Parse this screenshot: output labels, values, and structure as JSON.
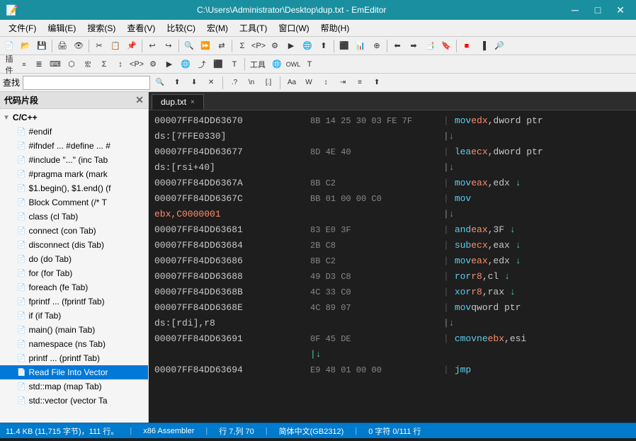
{
  "titlebar": {
    "title": "C:\\Users\\Administrator\\Desktop\\dup.txt - EmEditor",
    "minimize_label": "─",
    "maximize_label": "□",
    "close_label": "✕"
  },
  "menubar": {
    "items": [
      "文件(F)",
      "编辑(E)",
      "搜索(S)",
      "查看(V)",
      "比较(C)",
      "宏(M)",
      "工具(T)",
      "窗口(W)",
      "帮助(H)"
    ]
  },
  "searchbar": {
    "label": "查找",
    "placeholder": ""
  },
  "sidebar": {
    "title": "代码片段",
    "items": [
      {
        "id": "cpp-group",
        "label": "C/C++",
        "type": "folder",
        "expanded": true
      },
      {
        "id": "endif",
        "label": "#endif",
        "indent": 1
      },
      {
        "id": "ifndef",
        "label": "#ifndef ... #define ... #",
        "indent": 1
      },
      {
        "id": "include",
        "label": "#include \"...\" (inc Tab",
        "indent": 1
      },
      {
        "id": "pragma",
        "label": "#pragma mark (mark",
        "indent": 1
      },
      {
        "id": "begin",
        "label": "$1.begin(), $1.end() (f",
        "indent": 1
      },
      {
        "id": "block-comment",
        "label": "Block Comment (/* T",
        "indent": 1
      },
      {
        "id": "class",
        "label": "class (cl Tab)",
        "indent": 1
      },
      {
        "id": "connect",
        "label": "connect (con Tab)",
        "indent": 1
      },
      {
        "id": "disconnect",
        "label": "disconnect (dis Tab)",
        "indent": 1
      },
      {
        "id": "do",
        "label": "do (do Tab)",
        "indent": 1
      },
      {
        "id": "for",
        "label": "for (for Tab)",
        "indent": 1
      },
      {
        "id": "foreach",
        "label": "foreach (fe Tab)",
        "indent": 1
      },
      {
        "id": "fprintf",
        "label": "fprintf ... (fprintf Tab)",
        "indent": 1
      },
      {
        "id": "if",
        "label": "if (if Tab)",
        "indent": 1
      },
      {
        "id": "main",
        "label": "main() (main Tab)",
        "indent": 1
      },
      {
        "id": "namespace",
        "label": "namespace (ns Tab)",
        "indent": 1
      },
      {
        "id": "printf",
        "label": "printf ... (printf Tab)",
        "indent": 1
      },
      {
        "id": "read-file",
        "label": "Read File Into Vector",
        "indent": 1
      },
      {
        "id": "stdmap",
        "label": "std::map (map Tab)",
        "indent": 1
      },
      {
        "id": "stdvector",
        "label": "std::vector (vector Ta",
        "indent": 1
      }
    ]
  },
  "tab": {
    "filename": "dup.txt",
    "close_label": "×"
  },
  "editor": {
    "lines": [
      {
        "addr": "00007FF84DD63670",
        "bytes": "8B 14 25 30 03 FE 7F",
        "comment": "|",
        "asm": "mov",
        "ops": [
          "edx",
          ",dword ptr"
        ]
      },
      {
        "addr": "ds:[7FFE0330]",
        "bytes": "",
        "comment": "|↓",
        "asm": "",
        "ops": []
      },
      {
        "addr": "00007FF84DD63677",
        "bytes": "8D 4E 40",
        "comment": "|",
        "asm": "lea",
        "ops": [
          "ecx",
          ",dword ptr"
        ]
      },
      {
        "addr": "ds:[rsi+40]",
        "bytes": "",
        "comment": "|↓",
        "asm": "",
        "ops": []
      },
      {
        "addr": "00007FF84DD6367A",
        "bytes": "8B C2",
        "comment": "|",
        "asm": "mov",
        "ops": [
          "eax",
          ",edx"
        ]
      },
      {
        "addr": "00007FF84DD6367C",
        "bytes": "BB 01 00 00 C0",
        "comment": "|",
        "asm": "mov",
        "ops": []
      },
      {
        "addr": "ebx,C0000001",
        "bytes": "",
        "comment": "|↓",
        "asm": "",
        "ops": []
      },
      {
        "addr": "00007FF84DD63681",
        "bytes": "83 E0 3F",
        "comment": "|",
        "asm": "and",
        "ops": [
          "eax",
          ",3F"
        ]
      },
      {
        "addr": "00007FF84DD63684",
        "bytes": "2B C8",
        "comment": "|",
        "asm": "sub",
        "ops": [
          "ecx",
          ",eax"
        ]
      },
      {
        "addr": "00007FF84DD63686",
        "bytes": "8B C2",
        "comment": "|",
        "asm": "mov",
        "ops": [
          "eax",
          ",edx"
        ]
      },
      {
        "addr": "00007FF84DD63688",
        "bytes": "49 D3 C8",
        "comment": "|",
        "asm": "ror",
        "ops": [
          "r8",
          ",cl"
        ]
      },
      {
        "addr": "00007FF84DD6368B",
        "bytes": "4C 33 C0",
        "comment": "|",
        "asm": "xor",
        "ops": [
          "r8",
          ",rax"
        ]
      },
      {
        "addr": "00007FF84DD6368E",
        "bytes": "4C 89 07",
        "comment": "|",
        "asm": "mov",
        "ops": [
          "qword ptr"
        ]
      },
      {
        "addr": "ds:[rdi],r8",
        "bytes": "",
        "comment": "|↓",
        "asm": "",
        "ops": []
      },
      {
        "addr": "00007FF84DD63691",
        "bytes": "0F 45 DE",
        "comment": "|",
        "asm": "cmovne",
        "ops": [
          "ebx",
          ",esi"
        ]
      },
      {
        "addr": "",
        "bytes": "|↓",
        "comment": "",
        "asm": "",
        "ops": []
      },
      {
        "addr": "00007FF84DD63694",
        "bytes": "E9 48 01 00 00",
        "comment": "|",
        "asm": "jmp",
        "ops": []
      }
    ]
  },
  "statusbar": {
    "filesize": "11.4 KB (11,715 字节)，111 行。",
    "mode": "x86 Assembler",
    "position": "行 7,列 70",
    "encoding": "简体中文(GB2312)",
    "selection": "0 字符 0/111 行"
  }
}
